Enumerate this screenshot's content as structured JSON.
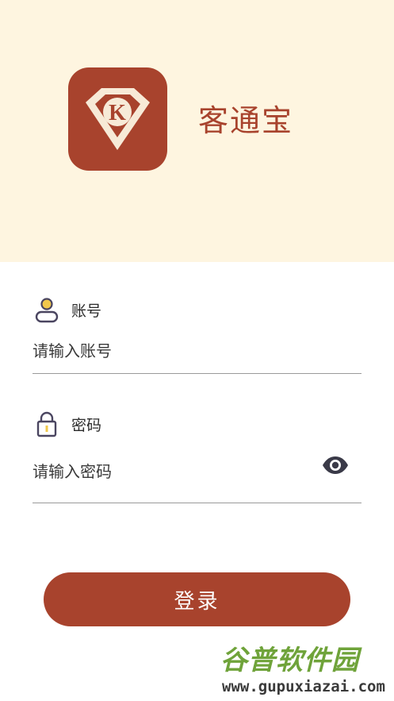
{
  "app": {
    "name": "客通宝",
    "logo_letter": "K",
    "brand_color": "#a8432d",
    "hero_background": "#fef5e0"
  },
  "account": {
    "label": "账号",
    "placeholder": "请输入账号",
    "value": "",
    "icon": "user-icon"
  },
  "password": {
    "label": "密码",
    "placeholder": "请输入密码",
    "value": "",
    "icon": "lock-icon",
    "toggle_icon": "eye-icon"
  },
  "login_button": {
    "label": "登录"
  },
  "watermark": {
    "title": "谷普软件园",
    "url": "www.gupuxiazai.com"
  }
}
